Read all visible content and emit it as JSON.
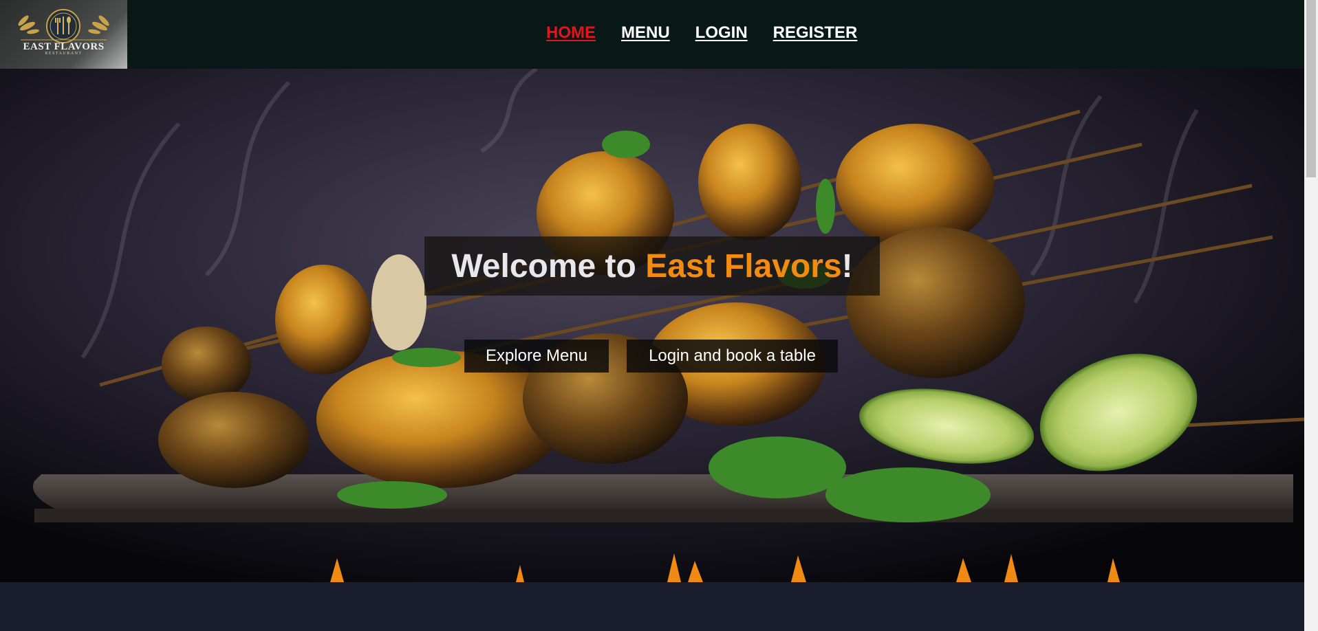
{
  "header": {
    "logo": {
      "name": "EAST FLAVORS",
      "tagline": "RESTAURANT"
    },
    "nav": [
      {
        "label": "HOME",
        "active": true
      },
      {
        "label": "MENU",
        "active": false
      },
      {
        "label": "LOGIN",
        "active": false
      },
      {
        "label": "REGISTER",
        "active": false
      }
    ]
  },
  "hero": {
    "title_prefix": "Welcome to ",
    "title_brand": "East Flavors",
    "title_suffix": "!",
    "buttons": {
      "explore": "Explore Menu",
      "login_book": "Login and book a table"
    }
  },
  "colors": {
    "nav_bg": "#071817",
    "active_link": "#e4141a",
    "brand_accent": "#f28c10",
    "page_bg": "#1a1d2e"
  }
}
